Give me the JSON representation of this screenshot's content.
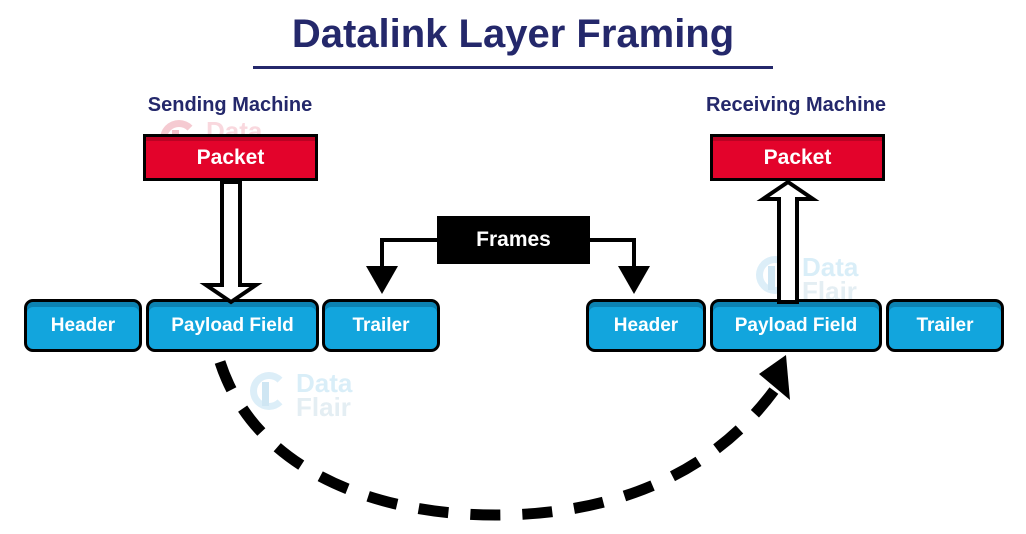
{
  "title": {
    "text": "Datalink Layer Framing",
    "color": "#24286b"
  },
  "colors": {
    "title": "#24286b",
    "packet_fill": "#e3032b",
    "field_fill": "#12a5dd",
    "frames_fill": "#000000",
    "stroke": "#000000",
    "background": "#ffffff"
  },
  "sending": {
    "label": "Sending Machine",
    "packet_label": "Packet",
    "fields": [
      {
        "label": "Header"
      },
      {
        "label": "Payload Field"
      },
      {
        "label": "Trailer"
      }
    ]
  },
  "receiving": {
    "label": "Receiving Machine",
    "packet_label": "Packet",
    "fields": [
      {
        "label": "Header"
      },
      {
        "label": "Payload Field"
      },
      {
        "label": "Trailer"
      }
    ]
  },
  "frames": {
    "label": "Frames"
  },
  "watermark": {
    "line1": "Data",
    "line2": "Flair"
  }
}
